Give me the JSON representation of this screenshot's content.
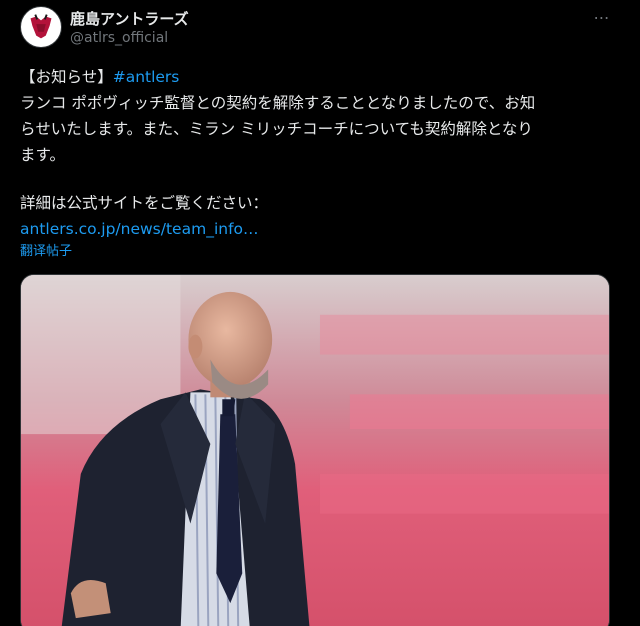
{
  "account": {
    "display_name": "鹿島アントラーズ",
    "handle": "@atlrs_official",
    "avatar_icon": "antlers-logo-icon",
    "more_icon": "more-options-icon"
  },
  "post": {
    "line1_prefix": "【お知らせ】",
    "line1_hashtag": "#antlers",
    "line2": "ランコ ポポヴィッチ監督との契約を解除することとなりましたので、お知",
    "line3": "らせいたします。また、ミラン ミリッチコーチについても契約解除となり",
    "line4": "ます。",
    "line5": "詳細は公式サイトをご覧ください：",
    "link": "antlers.co.jp/news/team_info…",
    "translate": "翻译帖子"
  },
  "colors": {
    "background": "#000000",
    "text": "#e7e9ea",
    "secondary": "#71767b",
    "link": "#1d9bf0"
  }
}
